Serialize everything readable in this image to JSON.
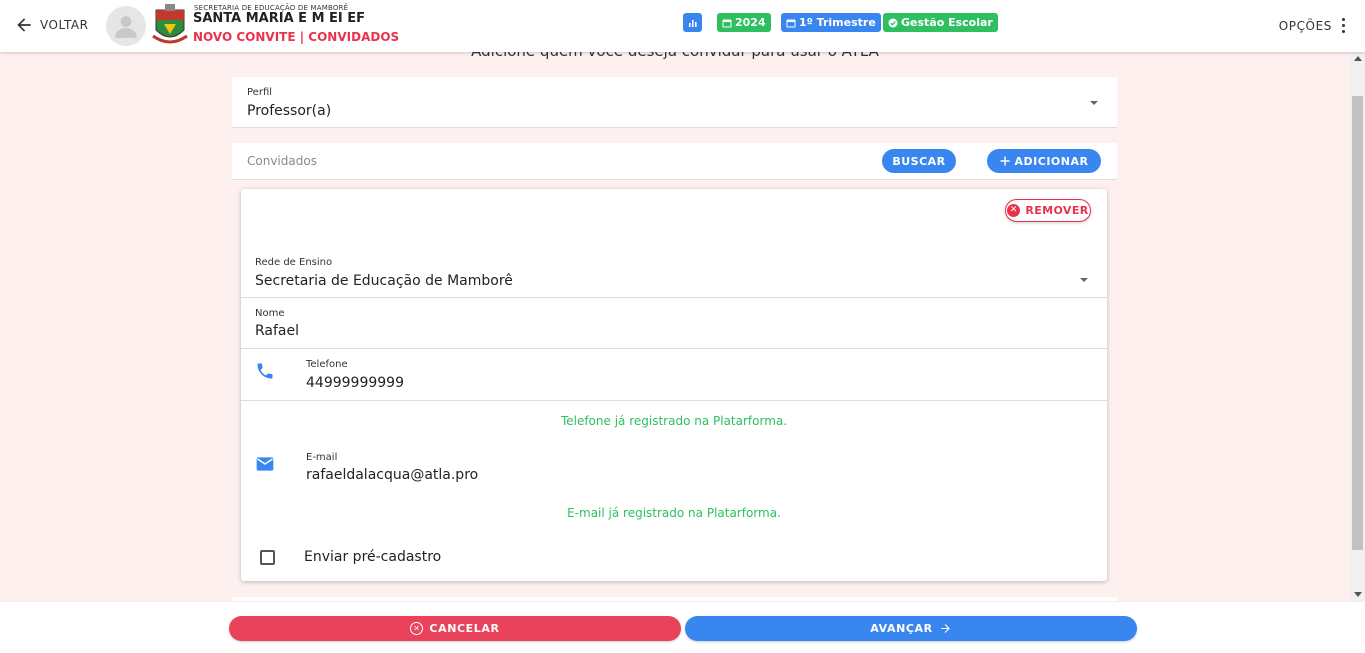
{
  "header": {
    "back_label": "VOLTAR",
    "org_small": "SECRETARIA DE EDUCAÇÃO DE MAMBORÊ",
    "org_title": "SANTA MARIA E M EI EF",
    "page_subtitle": "NOVO CONVITE | CONVIDADOS",
    "chips": [
      {
        "icon": "chart-icon",
        "label": "",
        "color": "#3a86f0"
      },
      {
        "icon": "calendar-icon",
        "label": "2024",
        "color": "#2ec060"
      },
      {
        "icon": "calendar-icon",
        "label": "1º Trimestre",
        "color": "#3a86f0"
      },
      {
        "icon": "check-circle-icon",
        "label": "Gestão Escolar",
        "color": "#2ec060"
      }
    ],
    "options_label": "OPÇÕES"
  },
  "main": {
    "intro": "Adicione quem você deseja convidar para usar o ATLA",
    "perfil": {
      "label": "Perfil",
      "value": "Professor(a)"
    },
    "convidados": {
      "label": "Convidados",
      "search_label": "BUSCAR",
      "add_label": "ADICIONAR"
    },
    "card": {
      "remove_label": "REMOVER",
      "rede": {
        "label": "Rede de Ensino",
        "value": "Secretaria de Educação de Mamborê"
      },
      "nome": {
        "label": "Nome",
        "value": "Rafael"
      },
      "telefone": {
        "label": "Telefone",
        "value": "44999999999",
        "message": "Telefone já registrado na Platarforma."
      },
      "email": {
        "label": "E-mail",
        "value": "rafaeldalacqua@atla.pro",
        "message": "E-mail já registrado na Platarforma."
      },
      "checkbox_label": "Enviar pré-cadastro"
    }
  },
  "footer": {
    "cancel_label": "CANCELAR",
    "next_label": "AVANÇAR"
  },
  "colors": {
    "primary": "#3a86f0",
    "danger": "#e8334b",
    "success": "#2ec060",
    "background": "#fdf0ef"
  }
}
